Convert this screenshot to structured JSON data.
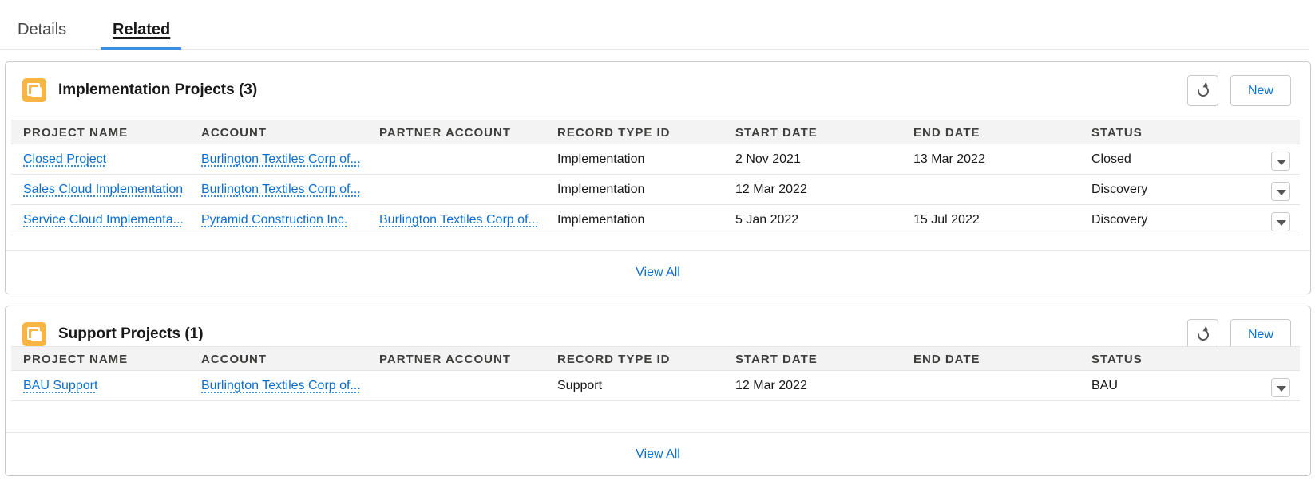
{
  "tabs": [
    {
      "label": "Details",
      "active": false
    },
    {
      "label": "Related",
      "active": true
    }
  ],
  "columns": [
    "PROJECT NAME",
    "ACCOUNT",
    "PARTNER ACCOUNT",
    "RECORD TYPE ID",
    "START DATE",
    "END DATE",
    "STATUS"
  ],
  "cards": [
    {
      "title": "Implementation Projects (3)",
      "icon": "project-icon",
      "new_label": "New",
      "view_all_label": "View All",
      "rows": [
        {
          "project_name": "Closed Project",
          "account": "Burlington Textiles Corp of...",
          "partner_account": "",
          "record_type": "Implementation",
          "start_date": "2 Nov 2021",
          "end_date": "13 Mar 2022",
          "status": "Closed"
        },
        {
          "project_name": "Sales Cloud Implementation",
          "account": "Burlington Textiles Corp of...",
          "partner_account": "",
          "record_type": "Implementation",
          "start_date": "12 Mar 2022",
          "end_date": "",
          "status": "Discovery"
        },
        {
          "project_name": "Service Cloud Implementa...",
          "account": "Pyramid Construction Inc.",
          "partner_account": "Burlington Textiles Corp of...",
          "record_type": "Implementation",
          "start_date": "5 Jan 2022",
          "end_date": "15 Jul 2022",
          "status": "Discovery"
        }
      ]
    },
    {
      "title": "Support Projects (1)",
      "icon": "project-icon",
      "new_label": "New",
      "view_all_label": "View All",
      "rows": [
        {
          "project_name": "BAU Support",
          "account": "Burlington Textiles Corp of...",
          "partner_account": "",
          "record_type": "Support",
          "start_date": "12 Mar 2022",
          "end_date": "",
          "status": "BAU"
        }
      ]
    }
  ],
  "colors": {
    "link": "#0b6fd1",
    "tab_indicator": "#3a8ee6",
    "icon_bg": "#f9b543"
  }
}
